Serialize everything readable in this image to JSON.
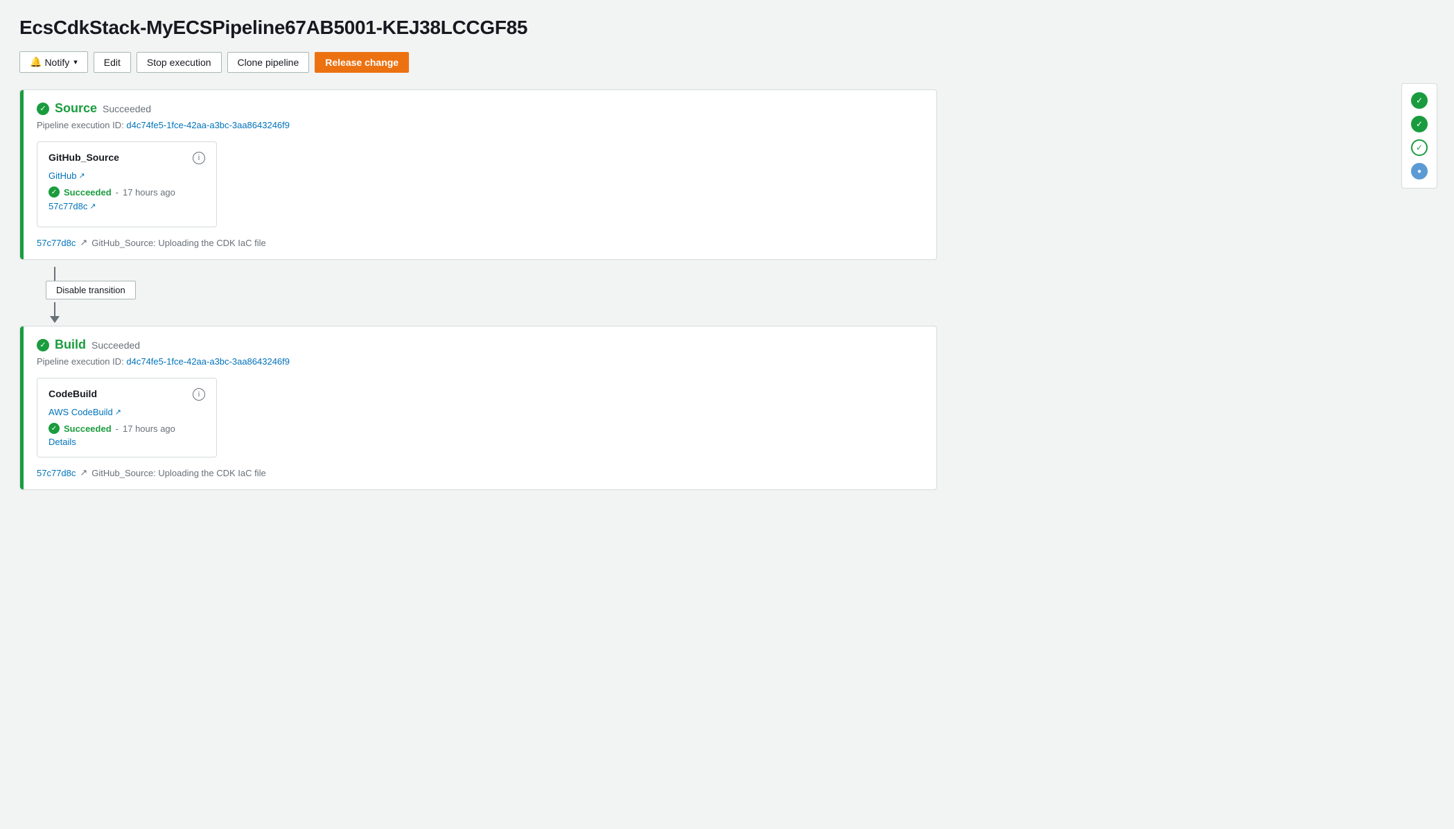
{
  "page": {
    "title": "EcsCdkStack-MyECSPipeline67AB5001-KEJ38LCCGF85"
  },
  "toolbar": {
    "notify_label": "Notify",
    "edit_label": "Edit",
    "stop_label": "Stop execution",
    "clone_label": "Clone pipeline",
    "release_label": "Release change"
  },
  "stages": [
    {
      "id": "source",
      "name": "Source",
      "status": "Succeeded",
      "exec_prefix": "Pipeline execution ID:",
      "exec_id": "d4c74fe5-1fce-42aa-a3bc-3aa8643246f9",
      "actions": [
        {
          "name": "GitHub_Source",
          "link_label": "GitHub",
          "link_icon": "↗",
          "status": "Succeeded",
          "time_ago": "17 hours ago",
          "commit_hash": "57c77d8c",
          "commit_icon": "↗",
          "details_label": null
        }
      ],
      "commit_row": {
        "hash": "57c77d8c",
        "icon": "↗",
        "message": "GitHub_Source: Uploading the CDK IaC file"
      }
    },
    {
      "id": "build",
      "name": "Build",
      "status": "Succeeded",
      "exec_prefix": "Pipeline execution ID:",
      "exec_id": "d4c74fe5-1fce-42aa-a3bc-3aa8643246f9",
      "actions": [
        {
          "name": "CodeBuild",
          "link_label": "AWS CodeBuild",
          "link_icon": "↗",
          "status": "Succeeded",
          "time_ago": "17 hours ago",
          "commit_hash": null,
          "commit_icon": null,
          "details_label": "Details"
        }
      ],
      "commit_row": {
        "hash": "57c77d8c",
        "icon": "↗",
        "message": "GitHub_Source: Uploading the CDK IaC file"
      }
    }
  ],
  "transition": {
    "disable_label": "Disable transition"
  },
  "sidebar": {
    "icons": [
      {
        "type": "success-filled",
        "label": "Stage 1 success"
      },
      {
        "type": "success-filled",
        "label": "Stage 2 success"
      },
      {
        "type": "success-outline",
        "label": "Stage 3 success"
      },
      {
        "type": "in-progress",
        "label": "Stage 4 in progress"
      }
    ]
  }
}
